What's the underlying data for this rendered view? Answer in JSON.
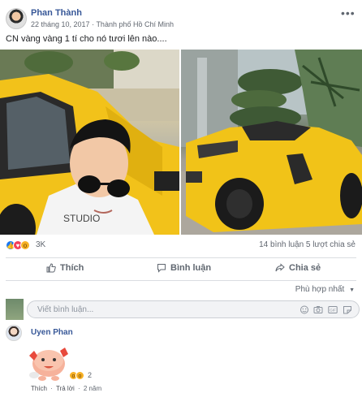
{
  "post": {
    "author": "Phan Thành",
    "date": "22 tháng 10, 2017",
    "location": "Thành phố Hồ Chí Minh",
    "separator": "·",
    "text": "CN vàng vàng 1 tí cho nó tươi lên nào....",
    "more_label": "•••"
  },
  "reactions": {
    "count": "3K",
    "comments_shares": "14 bình luận 5 lượt chia sẻ",
    "icons": [
      "like-icon",
      "love-icon",
      "wow-icon"
    ]
  },
  "actions": {
    "like_label": "Thích",
    "comment_label": "Bình luận",
    "share_label": "Chia sẻ"
  },
  "sort": {
    "label": "Phù hợp nhất",
    "caret": "▼"
  },
  "comment_box": {
    "placeholder": "Viết bình luận...",
    "icons": [
      "emoji-icon",
      "camera-icon",
      "gif-icon",
      "sticker-icon"
    ]
  },
  "comment": {
    "author": "Uyen Phan",
    "like_label": "Thích",
    "reply_label": "Trả lời",
    "time": "2 năm",
    "dot": "·",
    "reaction_count": "2"
  },
  "colors": {
    "brand_blue": "#385898",
    "like_blue": "#1877f2",
    "love_red": "#f33e58",
    "wow_yellow": "#f7b125",
    "car_yellow": "#f2c21a"
  }
}
